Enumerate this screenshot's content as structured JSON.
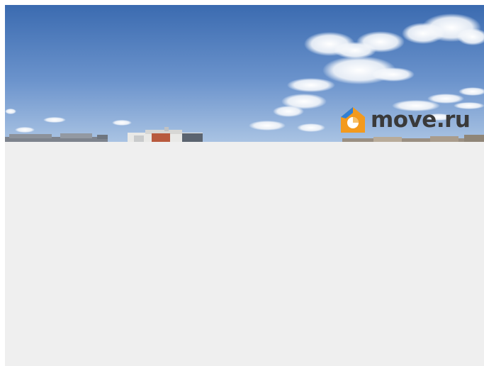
{
  "watermark": {
    "text": "move.ru",
    "icon": "house-logo-icon",
    "colors": {
      "orange": "#f39a1e",
      "blue": "#2f7fd6",
      "text": "#3a3a3a"
    }
  },
  "colors": {
    "sky_top": "#3f6fb3",
    "sky_bottom": "#9dbbe0",
    "empty_area": "#efefef"
  }
}
